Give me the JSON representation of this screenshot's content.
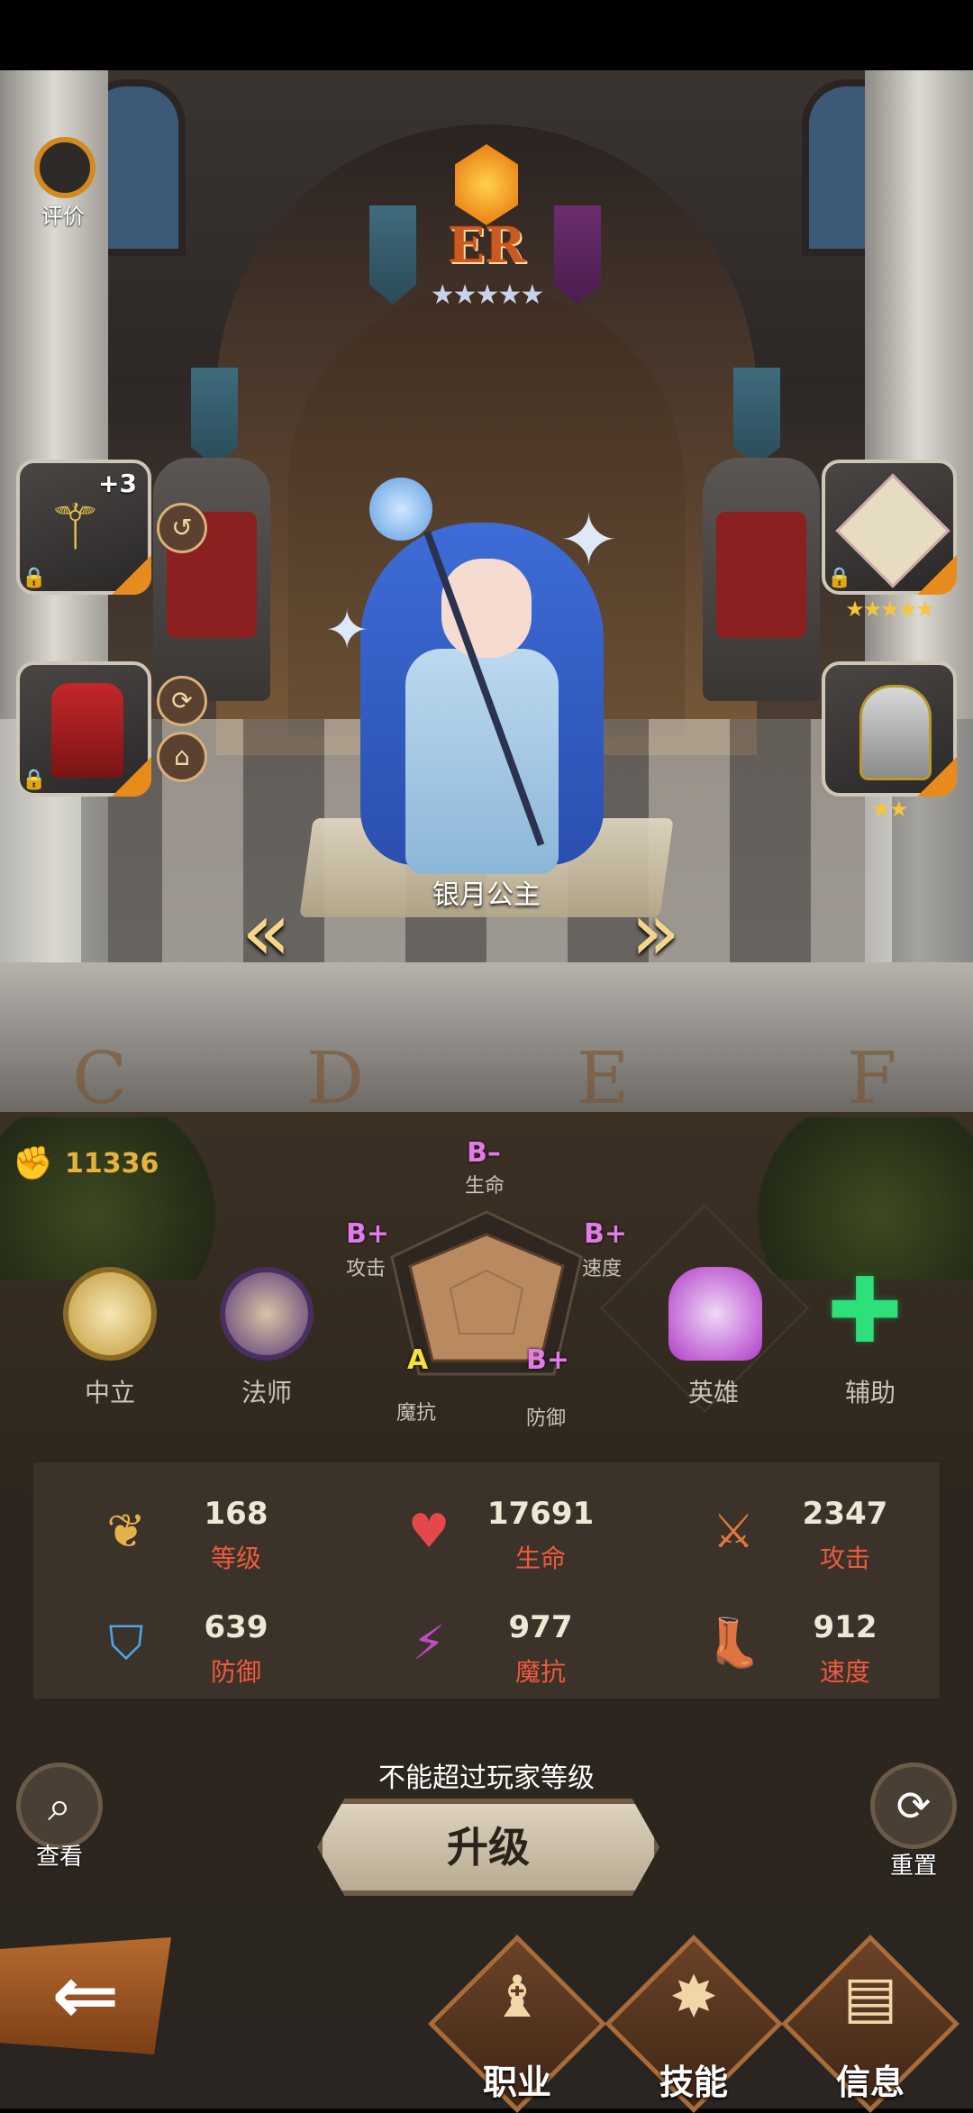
{
  "rarity": {
    "label": "ER",
    "stars": "★★★★★"
  },
  "review": {
    "label": "评价"
  },
  "hero": {
    "name": "银月公主"
  },
  "equipment": {
    "weapon": {
      "plus": "+3"
    },
    "accessory_stars": "★★★★★",
    "helmet_stars": "★★"
  },
  "background_letters": [
    "C",
    "D",
    "E",
    "F"
  ],
  "power": {
    "value": "11336"
  },
  "radar": {
    "hp": {
      "grade": "B–",
      "label": "生命"
    },
    "attack": {
      "grade": "B+",
      "label": "攻击"
    },
    "speed": {
      "grade": "B+",
      "label": "速度"
    },
    "magic_resist": {
      "grade": "A",
      "label": "魔抗"
    },
    "defense": {
      "grade": "B+",
      "label": "防御"
    }
  },
  "classes": [
    {
      "label": "中立",
      "icon": "wings-icon"
    },
    {
      "label": "法师",
      "icon": "mage-icon"
    },
    {
      "label": "英雄",
      "icon": "helmet-icon"
    },
    {
      "label": "辅助",
      "icon": "cross-icon"
    }
  ],
  "stats": [
    {
      "value": "168",
      "label": "等级",
      "icon": "laurel-icon",
      "color": "#e6b14a"
    },
    {
      "value": "17691",
      "label": "生命",
      "icon": "heart-icon",
      "color": "#e5484a"
    },
    {
      "value": "2347",
      "label": "攻击",
      "icon": "sword-icon",
      "color": "#e07a3a"
    },
    {
      "value": "639",
      "label": "防御",
      "icon": "shield-icon",
      "color": "#4aa6e6"
    },
    {
      "value": "977",
      "label": "魔抗",
      "icon": "lightning-shield-icon",
      "color": "#c14ac9"
    },
    {
      "value": "912",
      "label": "速度",
      "icon": "boot-icon",
      "color": "#36b27a"
    }
  ],
  "level_cap_text": "不能超过玩家等级",
  "buttons": {
    "level_up": "升级",
    "view": "查看",
    "reset": "重置",
    "back": "⇐"
  },
  "nav": [
    {
      "label": "职业",
      "icon": "chess-icon"
    },
    {
      "label": "技能",
      "icon": "skill-icon"
    },
    {
      "label": "信息",
      "icon": "scroll-icon"
    }
  ],
  "colors": {
    "accent": "#e78b1d",
    "grade_purple": "#e07be8",
    "grade_yellow": "#f3e23a",
    "stat_label": "#ef5a3c"
  }
}
